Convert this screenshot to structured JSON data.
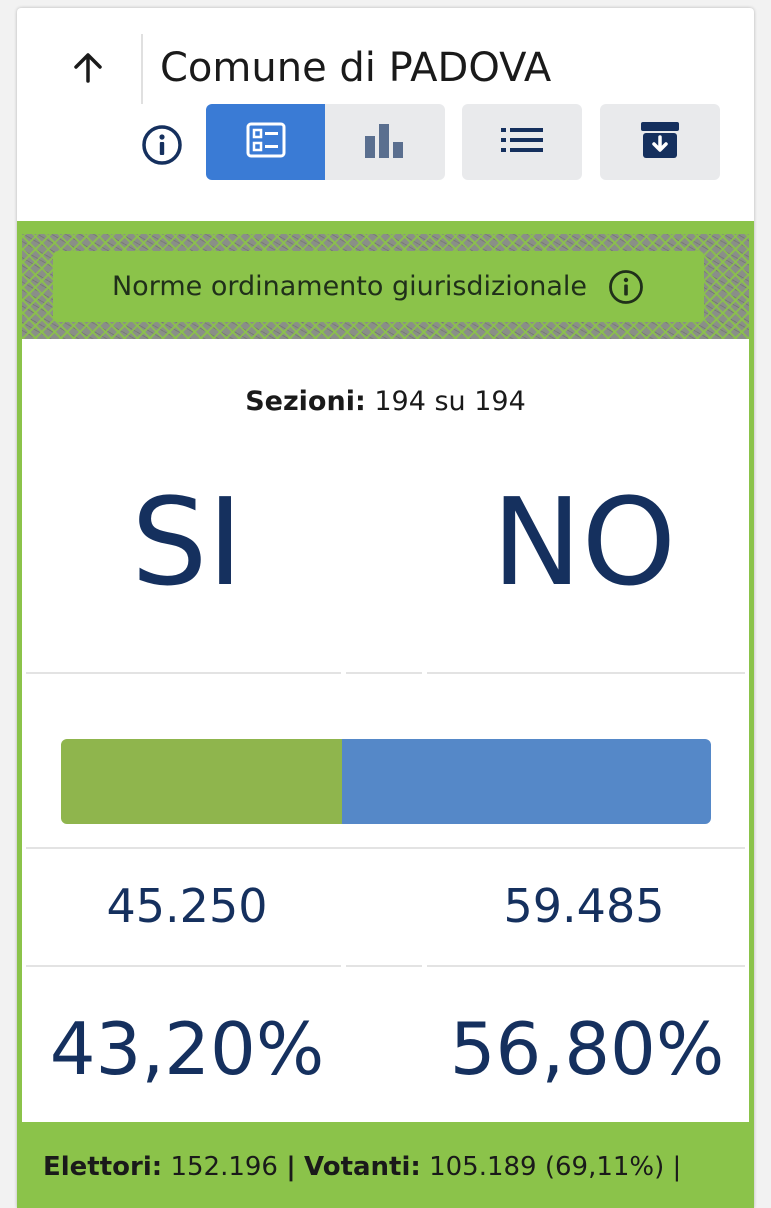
{
  "header": {
    "title": "Comune di PADOVA",
    "back_icon": "arrow-up-icon",
    "info_icon": "info-circle-icon"
  },
  "toolbar": {
    "buttons": [
      {
        "name": "list-view",
        "icon": "list-detail-icon",
        "active": true
      },
      {
        "name": "chart-view",
        "icon": "bar-chart-icon",
        "active": false
      },
      {
        "name": "items",
        "icon": "bullet-list-icon",
        "active": false
      },
      {
        "name": "archive",
        "icon": "archive-download-icon",
        "active": false
      }
    ]
  },
  "topic": {
    "label": "Norme ordinamento giurisdizionale",
    "info_icon": "info-circle-icon"
  },
  "sections": {
    "label": "Sezioni:",
    "value": "194 su 194"
  },
  "results": {
    "si": {
      "label": "SI",
      "votes": "45.250",
      "percent": "43,20%",
      "share": 0.432
    },
    "no": {
      "label": "NO",
      "votes": "59.485",
      "percent": "56,80%",
      "share": 0.568
    }
  },
  "footer": {
    "elettori_label": "Elettori:",
    "elettori_value": "152.196",
    "sep1": "|",
    "votanti_label": "Votanti:",
    "votanti_value": "105.189 (69,11%)",
    "sep2": "|"
  },
  "colors": {
    "accent": "#3a7bd5",
    "green": "#8bc34a",
    "si_bar": "#8fb54d",
    "no_bar": "#5588c8",
    "text_dark_blue": "#15305e"
  }
}
